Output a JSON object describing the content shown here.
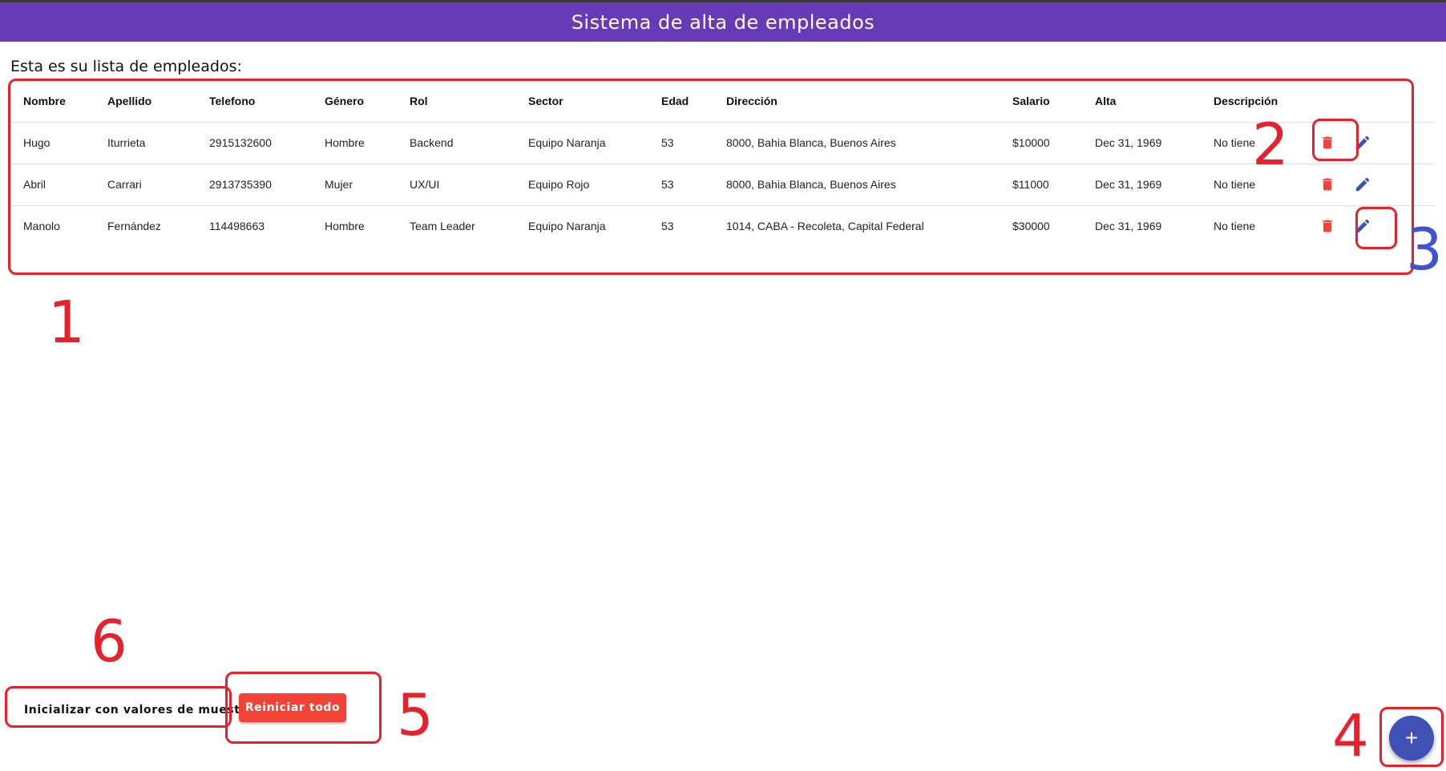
{
  "app": {
    "title": "Sistema de alta de empleados"
  },
  "subtitle": "Esta es su lista de empleados:",
  "table": {
    "headers": [
      "Nombre",
      "Apellido",
      "Telefono",
      "Género",
      "Rol",
      "Sector",
      "Edad",
      "Dirección",
      "Salario",
      "Alta",
      "Descripción"
    ],
    "rows": [
      [
        "Hugo",
        "Iturrieta",
        "2915132600",
        "Hombre",
        "Backend",
        "Equipo Naranja",
        "53",
        "8000, Bahia Blanca, Buenos Aires",
        "$10000",
        "Dec 31, 1969",
        "No tiene"
      ],
      [
        "Abril",
        "Carrari",
        "2913735390",
        "Mujer",
        "UX/UI",
        "Equipo Rojo",
        "53",
        "8000, Bahia Blanca, Buenos Aires",
        "$11000",
        "Dec 31, 1969",
        "No tiene"
      ],
      [
        "Manolo",
        "Fernández",
        "114498663",
        "Hombre",
        "Team Leader",
        "Equipo Naranja",
        "53",
        "1014, CABA - Recoleta, Capital Federal",
        "$30000",
        "Dec 31, 1969",
        "No tiene"
      ]
    ]
  },
  "icons": {
    "delete": "trash-icon",
    "edit": "pencil-icon",
    "add": "plus-icon"
  },
  "buttons": {
    "sample": "Inicializar con valores de muestra",
    "reset": "Reiniciar todo",
    "fab": "+"
  },
  "annotations": [
    "1",
    "2",
    "3",
    "4",
    "5",
    "6"
  ],
  "colors": {
    "appbar": "#673ab7",
    "delete": "#f44336",
    "edit": "#3f51b5",
    "annotation_red": "#e8202c",
    "annotation_blue": "#3f51d4"
  }
}
